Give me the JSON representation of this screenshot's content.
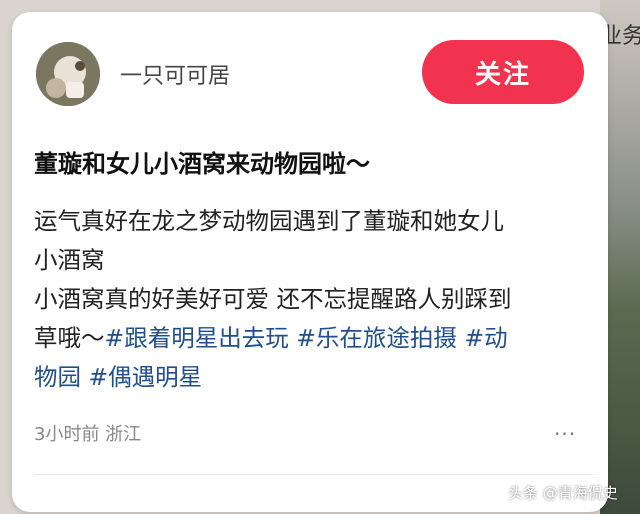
{
  "background": {
    "edge_text": "业务"
  },
  "post": {
    "author": "一只可可居",
    "follow_label": "关注",
    "title": "董璇和女儿小酒窝来动物园啦～",
    "lines": {
      "l1": "运气真好在龙之梦动物园遇到了董璇和她女儿",
      "l2": "小酒窝",
      "l3": "小酒窝真的好美好可爱 还不忘提醒路人别踩到",
      "l4_prefix": "草哦～",
      "l5_tail": "物园"
    },
    "hashtags": {
      "h1": "#跟着明星出去玩",
      "h2": "#乐在旅途拍摄",
      "h3_part1": "#动",
      "h4": "#偶遇明星"
    },
    "meta": "3小时前 浙江",
    "more_icon": "···"
  },
  "watermark": "头条 @青海侃史",
  "colors": {
    "follow_button": "#f2334f",
    "hashtag": "#1f4f8f"
  }
}
